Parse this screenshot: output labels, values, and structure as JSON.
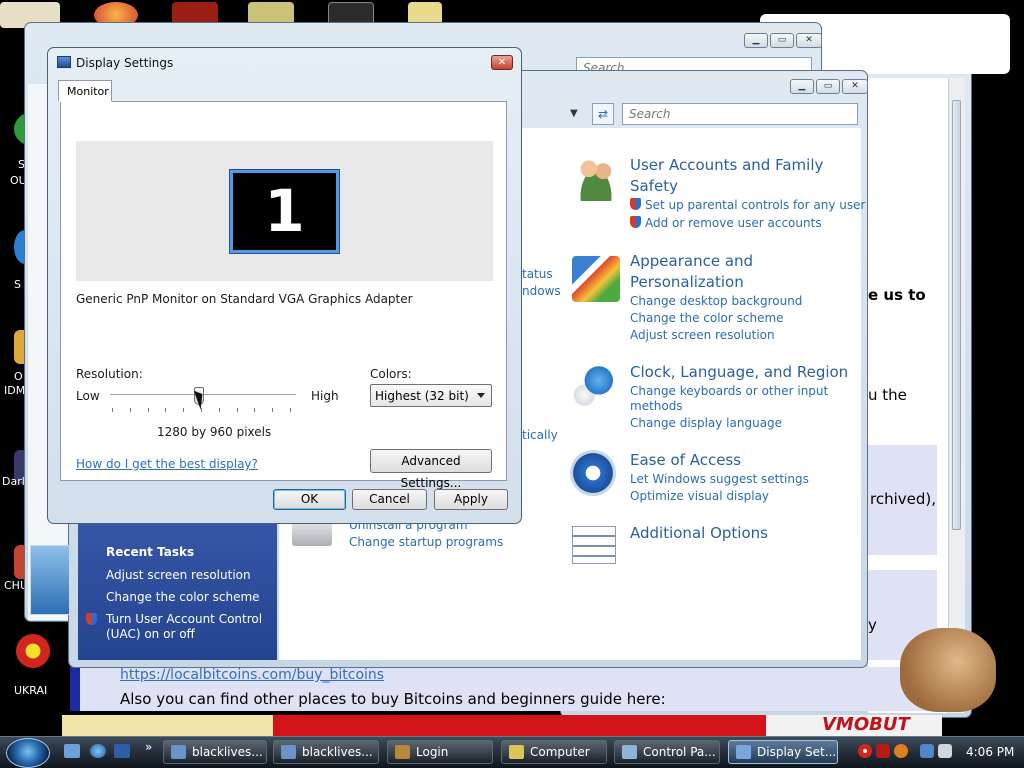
{
  "desktop": {
    "labels": [
      "S",
      "OU",
      "S",
      "O",
      "IDM",
      "Darl",
      "CHU",
      "UKRAI"
    ]
  },
  "bg_window": {
    "search_placeholder": "Search"
  },
  "control_panel": {
    "search_placeholder": "Search",
    "left_partial": [
      "tatus",
      "ndows",
      "tically"
    ],
    "left_links": [
      "Uninstall a program",
      "Change startup programs"
    ],
    "categories": [
      {
        "title": "User Accounts and Family Safety",
        "links": [
          "Set up parental controls for any user",
          "Add or remove user accounts"
        ]
      },
      {
        "title": "Appearance and Personalization",
        "links": [
          "Change desktop background",
          "Change the color scheme",
          "Adjust screen resolution"
        ]
      },
      {
        "title": "Clock, Language, and Region",
        "links": [
          "Change keyboards or other input methods",
          "Change display language"
        ]
      },
      {
        "title": "Ease of Access",
        "links": [
          "Let Windows suggest settings",
          "Optimize visual display"
        ]
      },
      {
        "title": "Additional Options",
        "links": []
      }
    ],
    "recent_tasks": {
      "heading": "Recent Tasks",
      "items": [
        "Adjust screen resolution",
        "Change the color scheme",
        "Turn User Account Control (UAC) on or off"
      ]
    }
  },
  "dialog": {
    "title": "Display Settings",
    "tab": "Monitor",
    "monitor_number": "1",
    "monitor_name": "Generic PnP Monitor on Standard VGA Graphics Adapter",
    "resolution_label": "Resolution:",
    "low": "Low",
    "high": "High",
    "resolution_value": "1280 by 960 pixels",
    "resolution_level": 0.49,
    "colors_label": "Colors:",
    "colors_value": "Highest (32 bit)",
    "help_link": "How do I get the best display?",
    "advanced_button": "Advanced Settings...",
    "ok": "OK",
    "cancel": "Cancel",
    "apply": "Apply"
  },
  "browser": {
    "fragments": [
      "e us to",
      "u the",
      "rchived),",
      "y"
    ],
    "url_link": "https://localbitcoins.com/buy_bitcoins",
    "bottom_text": "Also you can find other places to buy Bitcoins and beginners guide here:",
    "banner": "VMOBUT"
  },
  "taskbar": {
    "items": [
      {
        "label": "blacklives...",
        "color": "#6a93c9"
      },
      {
        "label": "blacklives...",
        "color": "#6a93c9"
      },
      {
        "label": "Login",
        "color": "#b9863b"
      },
      {
        "label": "Computer",
        "color": "#d9c65a"
      },
      {
        "label": "Control Pa...",
        "color": "#8fb4d8"
      },
      {
        "label": "Display Set...",
        "color": "#7aa6de"
      }
    ],
    "clock": "4:06 PM"
  },
  "colors": {
    "accent_blue": "#2b6cb5",
    "title_blue": "#2a5fa0",
    "sidebar_blue": "#2f4f9e"
  }
}
